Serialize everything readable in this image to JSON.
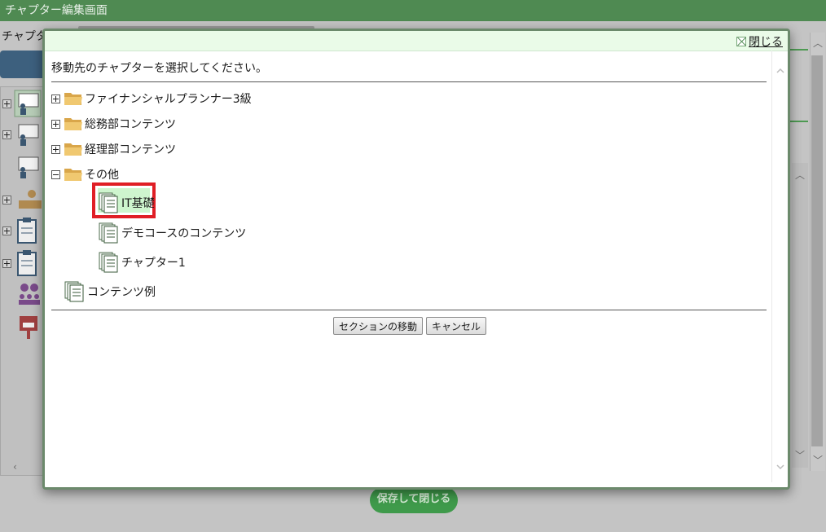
{
  "background": {
    "title": "チャプター編集画面",
    "chapter_label": "チャプタ",
    "save_close_label": "保存して閉じる",
    "colors": {
      "titlebar": "#4f8a52",
      "accent_green": "#3f9a4b"
    }
  },
  "dialog": {
    "close_label": "閉じる",
    "instruction": "移動先のチャプターを選択してください。",
    "tree": [
      {
        "label": "ファイナンシャルプランナー3級",
        "type": "folder",
        "toggle": "plus"
      },
      {
        "label": "総務部コンテンツ",
        "type": "folder",
        "toggle": "plus"
      },
      {
        "label": "経理部コンテンツ",
        "type": "folder",
        "toggle": "plus"
      },
      {
        "label": "その他",
        "type": "folder",
        "toggle": "minus",
        "children": [
          {
            "label": "IT基礎",
            "type": "chapter",
            "selected": true
          },
          {
            "label": "デモコースのコンテンツ",
            "type": "chapter"
          },
          {
            "label": "チャプター1",
            "type": "chapter"
          }
        ]
      },
      {
        "label": "コンテンツ例",
        "type": "chapter"
      }
    ],
    "move_section_label": "セクションの移動",
    "cancel_label": "キャンセル",
    "colors": {
      "header_bg": "#eafbe8",
      "selected_border": "#e01e25",
      "selected_bg": "#cef5ce"
    }
  }
}
